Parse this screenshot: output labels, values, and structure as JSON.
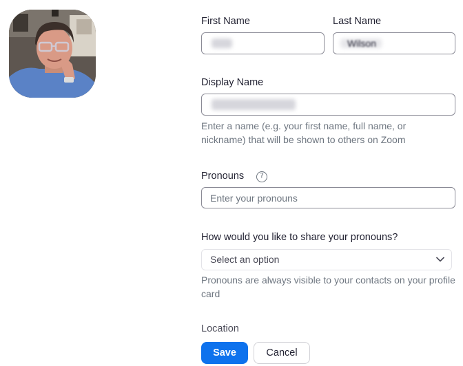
{
  "profile": {
    "avatar_icon": "profile-photo"
  },
  "form": {
    "first_name": {
      "label": "First Name",
      "value": ""
    },
    "last_name": {
      "label": "Last Name",
      "value": "Wilson"
    },
    "display_name": {
      "label": "Display Name",
      "value": "",
      "help": "Enter a name (e.g. your first name, full name, or nickname) that will be shown to others on Zoom"
    },
    "pronouns": {
      "label": "Pronouns",
      "help_icon": "?",
      "placeholder": "Enter your pronouns"
    },
    "share_pronouns": {
      "label": "How would you like to share your pronouns?",
      "selected": "Select an option",
      "help": "Pronouns are always visible to your contacts on your profile card"
    },
    "location": {
      "label": "Location"
    }
  },
  "actions": {
    "save_label": "Save",
    "cancel_label": "Cancel"
  },
  "colors": {
    "primary": "#0e72ed",
    "text": "#232333",
    "muted": "#6e7680"
  }
}
